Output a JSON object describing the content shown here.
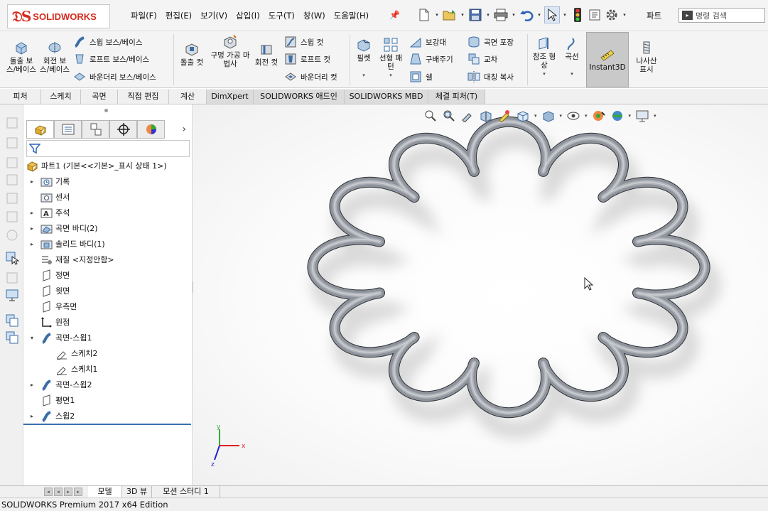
{
  "app": {
    "brand": "SOLIDWORKS",
    "edition_status": "SOLIDWORKS Premium 2017 x64 Edition"
  },
  "menu": [
    "파일(F)",
    "편집(E)",
    "보기(V)",
    "삽입(I)",
    "도구(T)",
    "창(W)",
    "도움말(H)"
  ],
  "document_label": "파트",
  "search": {
    "placeholder": "명령 검색"
  },
  "ribbon": {
    "extrude_boss": "돌출 보스/베이스",
    "revolve_boss": "회전 보스/베이스",
    "swept_boss": "스윕 보스/베이스",
    "loft_boss": "로프트 보스/베이스",
    "boundary_boss": "바운더리 보스/베이스",
    "extrude_cut": "돌출 컷",
    "hole_wizard": "구멍 가공 마법사",
    "revolve_cut": "회전 컷",
    "swept_cut": "스윕 컷",
    "loft_cut": "로프트 컷",
    "boundary_cut": "바운더리 컷",
    "fillet": "필렛",
    "linear_pattern": "선형 패턴",
    "rib": "보강대",
    "draft": "구배주기",
    "shell": "쉘",
    "wrap": "곡면 포장",
    "intersect": "교차",
    "mirror": "대칭 복사",
    "ref_geometry": "참조 형상",
    "curves": "곡선",
    "instant3d": "Instant3D",
    "helix_display": "나사산 표시"
  },
  "command_tabs": [
    "피처",
    "스케치",
    "곡면",
    "직접 편집",
    "계산",
    "DimXpert",
    "SOLIDWORKS 애드인",
    "SOLIDWORKS MBD",
    "체결 피처(T)"
  ],
  "tree": {
    "root": "파트1  (기본<<기본>_표시 상태 1>)",
    "items": [
      {
        "label": "기록",
        "icon": "history-folder-icon",
        "expand": true
      },
      {
        "label": "센서",
        "icon": "sensor-folder-icon",
        "expand": false
      },
      {
        "label": "주석",
        "icon": "annotations-folder-icon",
        "expand": true
      },
      {
        "label": "곡면 바디(2)",
        "icon": "surface-bodies-folder-icon",
        "expand": true
      },
      {
        "label": "솔리드 바디(1)",
        "icon": "solid-bodies-folder-icon",
        "expand": true
      },
      {
        "label": "재질 <지정안함>",
        "icon": "material-icon",
        "expand": false
      },
      {
        "label": "정면",
        "icon": "plane-icon",
        "expand": false
      },
      {
        "label": "윗면",
        "icon": "plane-icon",
        "expand": false
      },
      {
        "label": "우측면",
        "icon": "plane-icon",
        "expand": false
      },
      {
        "label": "원점",
        "icon": "origin-icon",
        "expand": false
      },
      {
        "label": "곡면-스윕1",
        "icon": "sweep-icon",
        "expand": "open"
      },
      {
        "label": "스케치2",
        "icon": "sketch-icon",
        "expand": false,
        "child": true
      },
      {
        "label": "스케치1",
        "icon": "sketch-icon",
        "expand": false,
        "child": true
      },
      {
        "label": "곡면-스윕2",
        "icon": "sweep-icon",
        "expand": true
      },
      {
        "label": "평면1",
        "icon": "plane-icon",
        "expand": false
      },
      {
        "label": "스윕2",
        "icon": "sweep-icon",
        "expand": true
      }
    ]
  },
  "bottom_tabs": [
    "모델",
    "3D 뷰",
    "모션 스터디 1"
  ],
  "triad": {
    "x": "x",
    "y": "y",
    "z": "z"
  },
  "colors": {
    "brand_red": "#d52b1e",
    "model_gray": "#8e939b",
    "selection_blue": "#3a6fb0"
  }
}
